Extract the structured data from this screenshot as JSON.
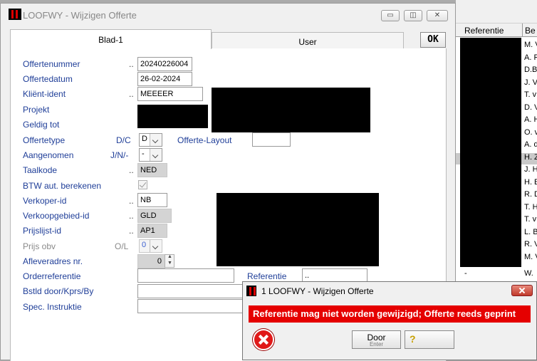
{
  "background_list": {
    "headers": [
      "Referentie",
      "Be"
    ],
    "rows": [
      "M. V",
      "A. F",
      "D.B",
      "J. V",
      "T. v",
      "D. V",
      "A. H",
      "O. v",
      "A. d",
      "H. Z",
      "J. H",
      "H. E",
      "R. D",
      "T. H",
      "T. v",
      "L. B",
      "R. V",
      "M. V"
    ],
    "bottom_left": "-",
    "bottom_right": "W."
  },
  "window": {
    "title": "LOOFWY - Wijzigen Offerte",
    "minimize_glyph": "▭",
    "restore_glyph": "◫",
    "close_glyph": "✕"
  },
  "tabs": {
    "blad1": "Blad-1",
    "user": "User"
  },
  "ok_label": "OK",
  "form": {
    "offertenummer": {
      "label": "Offertenummer",
      "dots": "..",
      "value": "20240226004"
    },
    "offertedatum": {
      "label": "Offertedatum",
      "value": "26-02-2024"
    },
    "klient": {
      "label": "Kliënt-ident",
      "dots": "..",
      "value": "MEEEER"
    },
    "projekt": {
      "label": "Projekt"
    },
    "geldig_tot": {
      "label": "Geldig tot"
    },
    "offertetype": {
      "label": "Offertetype",
      "code": "D/C",
      "value": "D"
    },
    "offerte_layout": {
      "label": "Offerte-Layout",
      "value": ""
    },
    "aangenomen": {
      "label": "Aangenomen",
      "code": "J/N/-",
      "value": "-"
    },
    "taalkode": {
      "label": "Taalkode",
      "dots": "..",
      "value": "NED"
    },
    "btw": {
      "label": "BTW aut. berekenen"
    },
    "verkoper": {
      "label": "Verkoper-id",
      "dots": "..",
      "value": "NB"
    },
    "verkoopgebied": {
      "label": "Verkoopgebied-id",
      "dots": "..",
      "value": "GLD"
    },
    "prijslijst": {
      "label": "Prijslijst-id",
      "dots": "..",
      "value": "AP1"
    },
    "prijs_obv": {
      "label": "Prijs obv",
      "code": "O/L",
      "value": "0"
    },
    "afleveradres": {
      "label": "Afleveradres nr.",
      "value": "0"
    },
    "orderreferentie": {
      "label": "Orderreferentie",
      "value": ""
    },
    "referentie": {
      "label": "Referentie",
      "value": ".."
    },
    "bstld": {
      "label": "Bstld door/Kprs/By",
      "value": ""
    },
    "spec": {
      "label": "Spec. Instruktie",
      "value": ""
    }
  },
  "dialog": {
    "title": "1 LOOFWY - Wijzigen Offerte",
    "message": "Referentie mag niet worden gewijzigd; Offerte reeds geprint",
    "door_label": "Door",
    "door_sub": "Enter",
    "help_glyph": "?"
  }
}
